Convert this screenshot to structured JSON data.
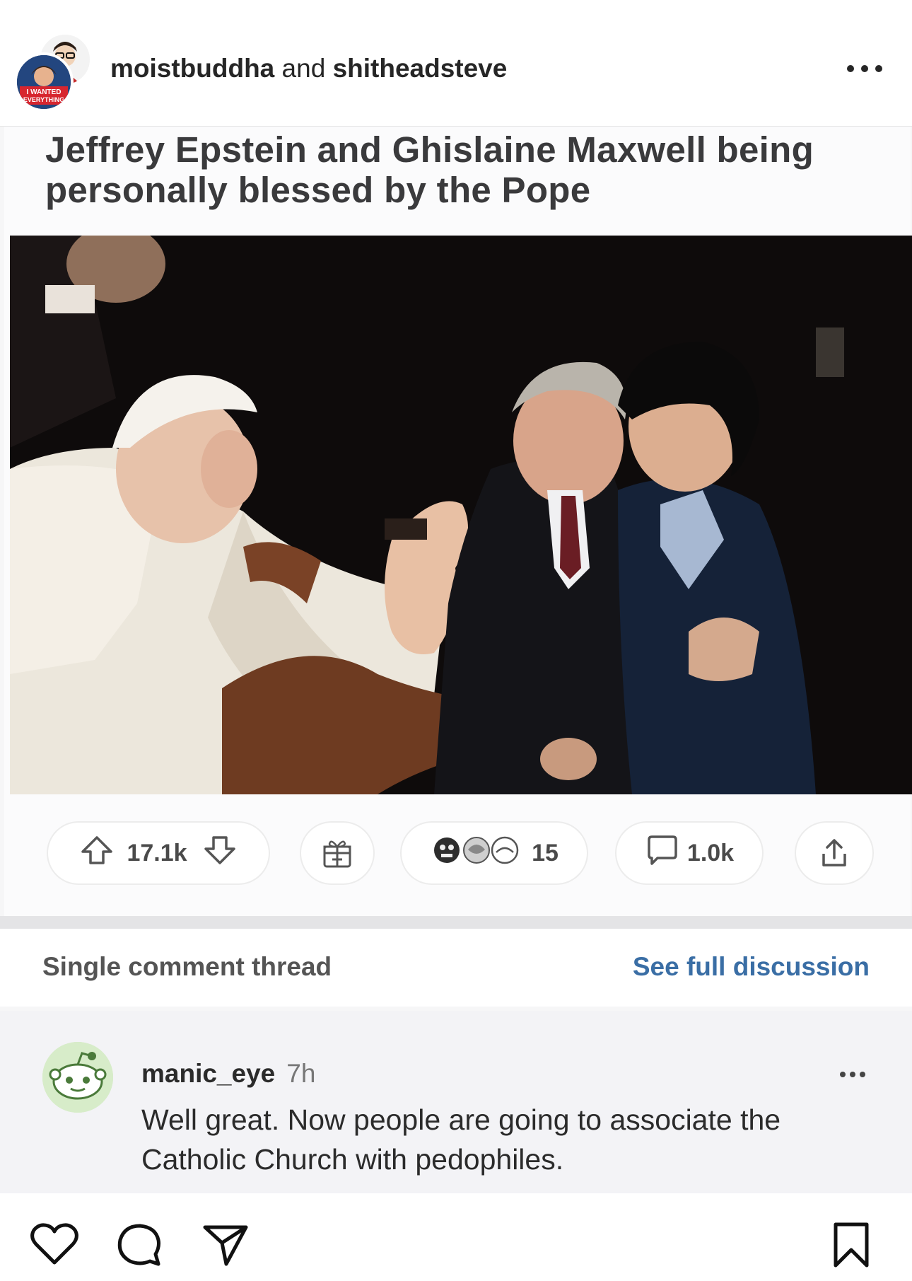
{
  "header": {
    "username_1": "moistbuddha",
    "joiner": " and ",
    "username_2": "shitheadsteve",
    "avatar_badge_line1": "I WANTED",
    "avatar_badge_line2": "EVERYTHING"
  },
  "post": {
    "title": "Jeffrey Epstein and Ghislaine Maxwell being personally blessed by the Pope",
    "upvotes": "17.1k",
    "awards_count": "15",
    "comments": "1.0k"
  },
  "thread": {
    "left_label": "Single comment thread",
    "right_label": "See full discussion"
  },
  "comment": {
    "user": "manic_eye",
    "time": "7h",
    "text": "Well great. Now people are going to associate the Catholic Church with pedophiles."
  },
  "icons": {
    "header_more": "more-horizontal-icon",
    "upvote": "arrow-up-icon",
    "downvote": "arrow-down-icon",
    "gift": "gift-icon",
    "comment": "comment-bubble-icon",
    "share": "share-icon",
    "like": "heart-icon",
    "ig_comment": "ig-comment-icon",
    "send": "send-icon",
    "save": "bookmark-icon"
  }
}
